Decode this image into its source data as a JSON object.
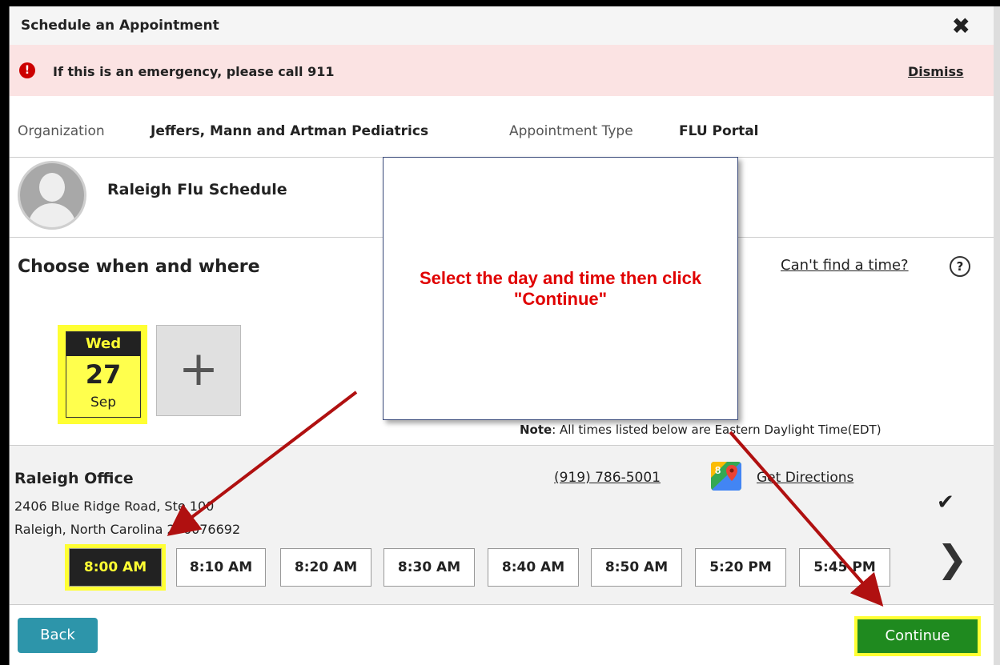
{
  "modal": {
    "title": "Schedule an Appointment",
    "close_glyph": "✖"
  },
  "alert": {
    "icon_glyph": "!",
    "message": "If this is an emergency, please call 911",
    "dismiss_label": "Dismiss"
  },
  "organization": {
    "label": "Organization",
    "value": "Jeffers, Mann and Artman Pediatrics",
    "appt_type_label": "Appointment Type",
    "appt_type_value": "FLU Portal"
  },
  "provider": {
    "name": "Raleigh Flu Schedule"
  },
  "when_where": {
    "heading": "Choose when and where",
    "cant_find": "Can't find a time?",
    "help_glyph": "?"
  },
  "date_card": {
    "weekday": "Wed",
    "day": "27",
    "month": "Sep"
  },
  "add_date_glyph": "+",
  "note": {
    "bold": "Note",
    "text": ": All times listed below are Eastern Daylight Time(EDT)"
  },
  "office": {
    "name": "Raleigh Office",
    "address_line1": "2406 Blue Ridge Road, Ste 100",
    "address_line2": "Raleigh, North Carolina 276076692",
    "phone": "(919) 786-5001",
    "directions": "Get Directions",
    "check_glyph": "✔",
    "next_glyph": "❯"
  },
  "time_slots": [
    "8:00 AM",
    "8:10 AM",
    "8:20 AM",
    "8:30 AM",
    "8:40 AM",
    "8:50 AM",
    "5:20 PM",
    "5:45 PM"
  ],
  "selected_slot": "8:00 AM",
  "footer": {
    "back_label": "Back",
    "continue_label": "Continue"
  },
  "callout": {
    "text": "Select the day and time then click \"Continue\""
  },
  "colors": {
    "highlight": "#ffff33",
    "alert_bg": "#fbe3e3",
    "back_btn": "#2d95aa",
    "continue_btn": "#1f8a1f",
    "callout_text": "#e00000",
    "arrow": "#b01010"
  }
}
